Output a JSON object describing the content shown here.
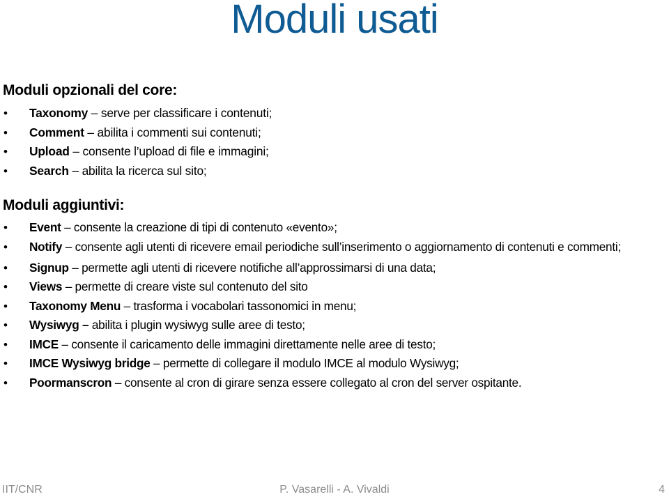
{
  "title": "Moduli usati",
  "sections": [
    {
      "heading": "Moduli opzionali del core:",
      "items": [
        {
          "name": "Taxonomy",
          "sep": " – ",
          "desc": "serve per classificare i contenuti;"
        },
        {
          "name": "Comment",
          "sep": " – ",
          "desc": "abilita i commenti sui contenuti;"
        },
        {
          "name": "Upload",
          "sep": " – ",
          "desc": "consente l’upload di file e immagini;"
        },
        {
          "name": "Search",
          "sep": " – ",
          "desc": "abilita la ricerca sul sito;"
        }
      ]
    },
    {
      "heading": "Moduli aggiuntivi:",
      "items": [
        {
          "name": "Event",
          "sep": " – ",
          "desc": "consente la creazione di tipi di contenuto «evento»;"
        },
        {
          "name": "Notify",
          "sep": " – ",
          "desc": "consente agli utenti di ricevere email periodiche sull’inserimento o aggiornamento di contenuti e commenti;"
        },
        {
          "name": "Signup",
          "sep": " – ",
          "desc": "permette agli utenti di ricevere notifiche all’approssimarsi di una data;"
        },
        {
          "name": "Views",
          "sep": " – ",
          "desc": "permette di creare viste sul contenuto del sito"
        },
        {
          "name": "Taxonomy Menu",
          "sep": " – ",
          "desc": "trasforma i vocabolari tassonomici in menu;"
        },
        {
          "name": "Wysiwyg –",
          "sep": " ",
          "desc": "abilita i plugin wysiwyg sulle aree di testo;"
        },
        {
          "name": "IMCE",
          "sep": " – ",
          "desc": "consente il caricamento delle immagini direttamente nelle aree di testo;"
        },
        {
          "name": "IMCE Wysiwyg bridge",
          "sep": " – ",
          "desc": "permette di collegare il modulo IMCE al modulo Wysiwyg;"
        },
        {
          "name": "Poormanscron",
          "sep": " – ",
          "desc": "consente al cron di girare senza essere collegato al cron del server ospitante."
        }
      ]
    }
  ],
  "footer": {
    "left": "IIT/CNR",
    "center": "P. Vasarelli - A. Vivaldi",
    "page_number": "4"
  },
  "bullet": "•",
  "colors": {
    "title": "#0f5b93",
    "footer": "#8c8c8c"
  }
}
